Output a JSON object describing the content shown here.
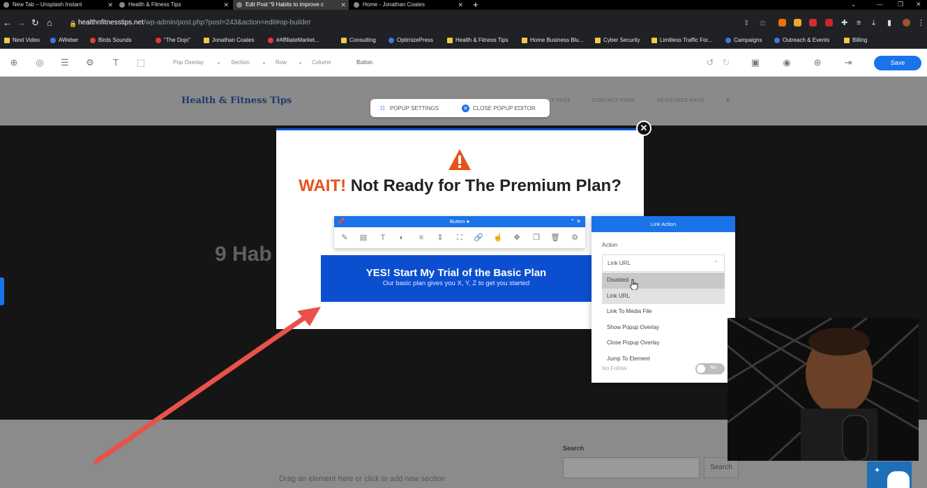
{
  "browser": {
    "tabs": [
      {
        "title": "New Tab – Unsplash Instant"
      },
      {
        "title": "Health & Fitness Tips"
      },
      {
        "title": "Edit Post “9 Habits to improve c"
      },
      {
        "title": "Home - Jonathan Coates"
      }
    ],
    "new_tab": "+",
    "url_domain": "healthnfitnesstips.net",
    "url_path": "/wp-admin/post.php?post=243&action=edit#op-builder",
    "bookmarks": [
      "Next Video",
      "AWeber",
      "Birds Sounds",
      "\"The Dojo\"",
      "Jonathan Coates",
      "#AffiliateMarket...",
      "Consulting",
      "OptimizePress",
      "Health & Fitness Tips",
      "Home Business Blu...",
      "Cyber Security",
      "Limitless Traffic For...",
      "Campaigns",
      "Outreach & Events",
      "Billing"
    ]
  },
  "builder": {
    "breadcrumbs": [
      "Pop Overlay",
      "Section",
      "Row",
      "Column",
      "Button"
    ],
    "save_label": "Save"
  },
  "site": {
    "logo": "Health & Fitness Tips",
    "nav": [
      "T PAGE",
      "CONTACT PAGE",
      "RESOURCE PAGE"
    ],
    "hero_title": "9 Hab",
    "drag_hint": "Drag an element here or click to add new section",
    "search_label": "Search",
    "search_button": "Search"
  },
  "popup_controls": {
    "settings": "POPUP SETTINGS",
    "close_editor": "CLOSE POPUP EDITOR"
  },
  "popup": {
    "headline_accent": "WAIT!",
    "headline_rest": " Not Ready for The Premium Plan?",
    "cta_main": "YES! Start My Trial of the Basic Plan",
    "cta_sub": "Our basic plan gives you X, Y, Z to get you started",
    "close_glyph": "✕"
  },
  "button_toolbar": {
    "title": "Button",
    "icons": [
      "magic-wand",
      "image",
      "text",
      "palette",
      "align",
      "spacing",
      "size",
      "link",
      "hover",
      "move",
      "duplicate",
      "delete",
      "settings"
    ]
  },
  "link_action": {
    "title": "Link Action",
    "label": "Action",
    "selected": "Link URL",
    "options": [
      "Disabled",
      "Link URL",
      "Link To Media File",
      "Show Popup Overlay",
      "Close Popup Overlay",
      "Jump To Element"
    ],
    "nofollow_label": "No Follow",
    "toggle_text": "No"
  },
  "colors": {
    "brand_blue": "#1a73e8",
    "cta_blue": "#0b4fd0",
    "warning_orange": "#e5531b",
    "annotation_arrow": "#e8524a"
  }
}
